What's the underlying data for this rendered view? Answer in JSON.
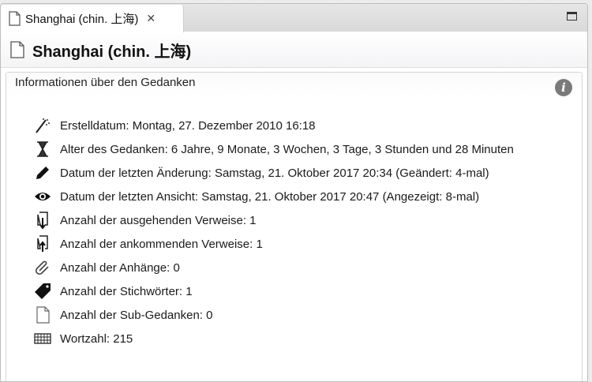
{
  "tab": {
    "title": "Shanghai (chin. 上海)"
  },
  "header": {
    "title": "Shanghai (chin. 上海)"
  },
  "section": {
    "title": "Informationen über den Gedanken"
  },
  "rows": [
    {
      "icon": "magic-wand-icon",
      "text": "Erstelldatum: Montag, 27. Dezember 2010 16:18"
    },
    {
      "icon": "hourglass-icon",
      "text": "Alter des Gedanken: 6 Jahre, 9 Monate, 3 Wochen, 3 Tage, 3 Stunden und 28 Minuten"
    },
    {
      "icon": "pencil-icon",
      "text": "Datum der letzten Änderung: Samstag, 21. Oktober 2017 20:34 (Geändert: 4-mal)"
    },
    {
      "icon": "eye-icon",
      "text": "Datum der letzten Ansicht: Samstag, 21. Oktober 2017 20:47 (Angezeigt: 8-mal)"
    },
    {
      "icon": "outgoing-link-icon",
      "text": "Anzahl der ausgehenden Verweise: 1"
    },
    {
      "icon": "incoming-link-icon",
      "text": "Anzahl der ankommenden Verweise: 1"
    },
    {
      "icon": "paperclip-icon",
      "text": "Anzahl der Anhänge: 0"
    },
    {
      "icon": "tag-icon",
      "text": "Anzahl der Stichwörter: 1"
    },
    {
      "icon": "document-icon",
      "text": "Anzahl der Sub-Gedanken: 0"
    },
    {
      "icon": "keyboard-icon",
      "text": "Wortzahl: 215"
    }
  ]
}
